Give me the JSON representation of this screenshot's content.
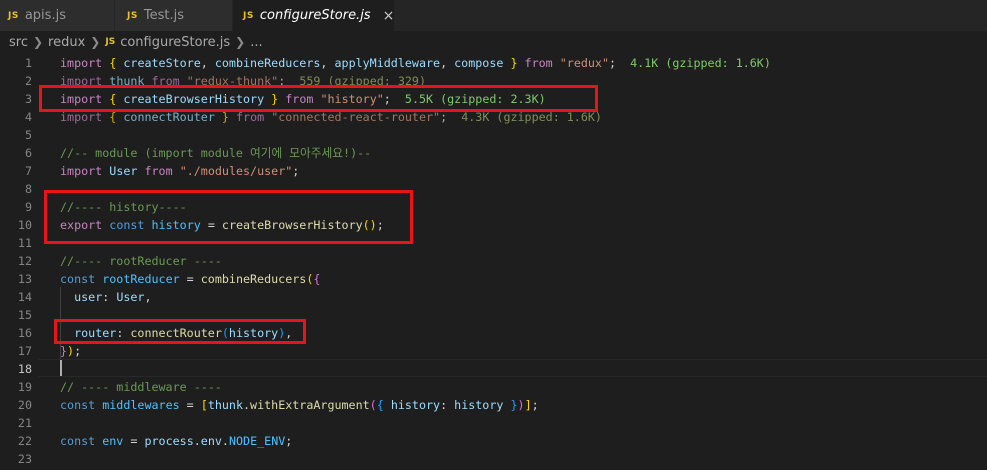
{
  "tabs": [
    {
      "icon": "JS",
      "label": "apis.js"
    },
    {
      "icon": "JS",
      "label": "Test.js"
    },
    {
      "icon": "JS",
      "label": "configureStore.js",
      "close": "×"
    }
  ],
  "breadcrumb": {
    "parts": [
      "src",
      "redux"
    ],
    "file_icon": "JS",
    "file": "configureStore.js",
    "trailing": "..."
  },
  "editor": {
    "line_numbers": [
      "1",
      "2",
      "3",
      "4",
      "5",
      "6",
      "7",
      "8",
      "9",
      "10",
      "11",
      "12",
      "13",
      "14",
      "15",
      "16",
      "17",
      "18",
      "19",
      "20",
      "21",
      "22",
      "23"
    ],
    "current_line": "18",
    "lines": {
      "l1": [
        {
          "c": "kw",
          "t": "import"
        },
        {
          "c": "",
          "t": " "
        },
        {
          "c": "br",
          "t": "{"
        },
        {
          "c": "",
          "t": " "
        },
        {
          "c": "id",
          "t": "createStore"
        },
        {
          "c": "",
          "t": ", "
        },
        {
          "c": "id",
          "t": "combineReducers"
        },
        {
          "c": "",
          "t": ", "
        },
        {
          "c": "id",
          "t": "applyMiddleware"
        },
        {
          "c": "",
          "t": ", "
        },
        {
          "c": "id",
          "t": "compose"
        },
        {
          "c": "",
          "t": " "
        },
        {
          "c": "br",
          "t": "}"
        },
        {
          "c": "",
          "t": " "
        },
        {
          "c": "kw",
          "t": "from"
        },
        {
          "c": "",
          "t": " "
        },
        {
          "c": "str",
          "t": "\"redux\""
        },
        {
          "c": "",
          "t": ";  "
        },
        {
          "c": "hint",
          "t": "4.1K (gzipped: 1.6K)"
        }
      ],
      "l2": [
        {
          "c": "kw",
          "t": "import"
        },
        {
          "c": "",
          "t": " "
        },
        {
          "c": "id",
          "t": "thunk"
        },
        {
          "c": "",
          "t": " "
        },
        {
          "c": "kw",
          "t": "from"
        },
        {
          "c": "",
          "t": " "
        },
        {
          "c": "str",
          "t": "\"redux-thunk\""
        },
        {
          "c": "",
          "t": ";  "
        },
        {
          "c": "hint2",
          "t": "559 (gzipped: 329)"
        }
      ],
      "l3": [
        {
          "c": "kw",
          "t": "import"
        },
        {
          "c": "",
          "t": " "
        },
        {
          "c": "br",
          "t": "{"
        },
        {
          "c": "",
          "t": " "
        },
        {
          "c": "id",
          "t": "createBrowserHistory"
        },
        {
          "c": "",
          "t": " "
        },
        {
          "c": "br",
          "t": "}"
        },
        {
          "c": "",
          "t": " "
        },
        {
          "c": "kw",
          "t": "from"
        },
        {
          "c": "",
          "t": " "
        },
        {
          "c": "str",
          "t": "\"history\""
        },
        {
          "c": "",
          "t": ";  "
        },
        {
          "c": "hint",
          "t": "5.5K (gzipped: 2.3K)"
        }
      ],
      "l4": [
        {
          "c": "kw",
          "t": "import"
        },
        {
          "c": "",
          "t": " "
        },
        {
          "c": "br",
          "t": "{"
        },
        {
          "c": "",
          "t": " "
        },
        {
          "c": "id",
          "t": "connectRouter"
        },
        {
          "c": "",
          "t": " "
        },
        {
          "c": "br",
          "t": "}"
        },
        {
          "c": "",
          "t": " "
        },
        {
          "c": "kw",
          "t": "from"
        },
        {
          "c": "",
          "t": " "
        },
        {
          "c": "str",
          "t": "\"connected-react-router\""
        },
        {
          "c": "",
          "t": ";  "
        },
        {
          "c": "hint2",
          "t": "4.3K (gzipped: 1.6K)"
        }
      ],
      "l5": [],
      "l6": [
        {
          "c": "cm",
          "t": "//-- module (import module 여기에 모아주세요!)--"
        }
      ],
      "l7": [
        {
          "c": "kw",
          "t": "import"
        },
        {
          "c": "",
          "t": " "
        },
        {
          "c": "id",
          "t": "User"
        },
        {
          "c": "",
          "t": " "
        },
        {
          "c": "kw",
          "t": "from"
        },
        {
          "c": "",
          "t": " "
        },
        {
          "c": "str",
          "t": "\"./modules/user\""
        },
        {
          "c": "",
          "t": ";"
        }
      ],
      "l8": [],
      "l9": [
        {
          "c": "cm",
          "t": "//---- history----"
        }
      ],
      "l10": [
        {
          "c": "kw",
          "t": "export"
        },
        {
          "c": "",
          "t": " "
        },
        {
          "c": "st",
          "t": "const"
        },
        {
          "c": "",
          "t": " "
        },
        {
          "c": "const",
          "t": "history"
        },
        {
          "c": "",
          "t": " = "
        },
        {
          "c": "fn",
          "t": "createBrowserHistory"
        },
        {
          "c": "br",
          "t": "()"
        },
        {
          "c": "",
          "t": ";"
        }
      ],
      "l11": [],
      "l12": [
        {
          "c": "cm",
          "t": "//---- rootReducer ----"
        }
      ],
      "l13": [
        {
          "c": "st",
          "t": "const"
        },
        {
          "c": "",
          "t": " "
        },
        {
          "c": "const",
          "t": "rootReducer"
        },
        {
          "c": "",
          "t": " = "
        },
        {
          "c": "fn",
          "t": "combineReducers"
        },
        {
          "c": "br",
          "t": "("
        },
        {
          "c": "br2",
          "t": "{"
        }
      ],
      "l14": [
        {
          "c": "",
          "t": "  "
        },
        {
          "c": "id",
          "t": "user"
        },
        {
          "c": "",
          "t": ": "
        },
        {
          "c": "id",
          "t": "User"
        },
        {
          "c": "",
          "t": ","
        }
      ],
      "l15": [],
      "l16": [
        {
          "c": "",
          "t": "  "
        },
        {
          "c": "id",
          "t": "router"
        },
        {
          "c": "",
          "t": ": "
        },
        {
          "c": "fn",
          "t": "connectRouter"
        },
        {
          "c": "br3",
          "t": "("
        },
        {
          "c": "id",
          "t": "history"
        },
        {
          "c": "br3",
          "t": ")"
        },
        {
          "c": "",
          "t": ","
        }
      ],
      "l17": [
        {
          "c": "br2",
          "t": "}"
        },
        {
          "c": "br",
          "t": ")"
        },
        {
          "c": "",
          "t": ";"
        }
      ],
      "l18": [],
      "l19": [
        {
          "c": "cm",
          "t": "// ---- middleware ----"
        }
      ],
      "l20": [
        {
          "c": "st",
          "t": "const"
        },
        {
          "c": "",
          "t": " "
        },
        {
          "c": "const",
          "t": "middlewares"
        },
        {
          "c": "",
          "t": " = "
        },
        {
          "c": "br",
          "t": "["
        },
        {
          "c": "id",
          "t": "thunk"
        },
        {
          "c": "",
          "t": "."
        },
        {
          "c": "fn",
          "t": "withExtraArgument"
        },
        {
          "c": "br2",
          "t": "("
        },
        {
          "c": "br3",
          "t": "{"
        },
        {
          "c": "",
          "t": " "
        },
        {
          "c": "id",
          "t": "history"
        },
        {
          "c": "",
          "t": ": "
        },
        {
          "c": "id",
          "t": "history"
        },
        {
          "c": "",
          "t": " "
        },
        {
          "c": "br3",
          "t": "}"
        },
        {
          "c": "br2",
          "t": ")"
        },
        {
          "c": "br",
          "t": "]"
        },
        {
          "c": "",
          "t": ";"
        }
      ],
      "l21": [],
      "l22": [
        {
          "c": "st",
          "t": "const"
        },
        {
          "c": "",
          "t": " "
        },
        {
          "c": "const",
          "t": "env"
        },
        {
          "c": "",
          "t": " = "
        },
        {
          "c": "id",
          "t": "process"
        },
        {
          "c": "",
          "t": "."
        },
        {
          "c": "id",
          "t": "env"
        },
        {
          "c": "",
          "t": "."
        },
        {
          "c": "const",
          "t": "NODE_ENV"
        },
        {
          "c": "",
          "t": ";"
        }
      ],
      "l23": []
    }
  },
  "colors": {
    "highlight_box": "#e8141a",
    "background": "#1e1e1e",
    "tab_inactive": "#2d2d2d"
  }
}
